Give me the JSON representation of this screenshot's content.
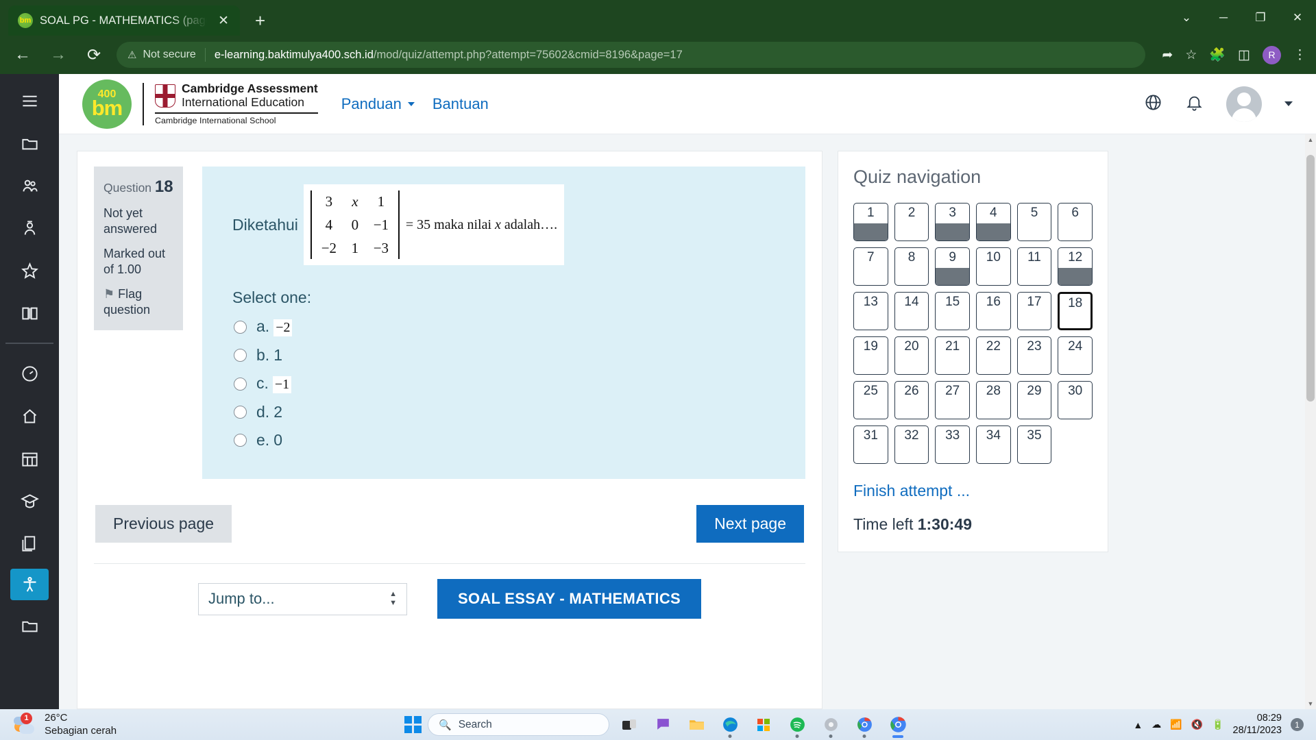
{
  "browser": {
    "tab": {
      "title": "SOAL PG - MATHEMATICS (page",
      "favicon": "bm-logo-icon",
      "close": "✕"
    },
    "new_tab": "+",
    "window_controls": {
      "minimize_group": "⌄",
      "minimize": "─",
      "maximize": "❐",
      "close": "✕"
    },
    "nav": {
      "back": "←",
      "forward": "→",
      "reload": "⟳"
    },
    "security_label": "Not secure",
    "url_host": "e-learning.baktimulya400.sch.id",
    "url_path": "/mod/quiz/attempt.php?attempt=75602&cmid=8196&page=17",
    "toolbar_icons": [
      "share-icon",
      "bookmark-star-icon",
      "extensions-puzzle-icon",
      "sidepanel-icon"
    ],
    "profile_initial": "R",
    "menu": "⋮"
  },
  "rail": {
    "items": [
      {
        "name": "hamburger-menu-icon"
      },
      {
        "name": "folder-icon"
      },
      {
        "name": "users-icon"
      },
      {
        "name": "badge-person-icon"
      },
      {
        "name": "star-icon"
      },
      {
        "name": "book-icon"
      },
      {
        "name": "dashboard-gauge-icon"
      },
      {
        "name": "home-icon"
      },
      {
        "name": "calendar-grid-icon"
      },
      {
        "name": "graduation-cap-icon"
      },
      {
        "name": "files-icon"
      },
      {
        "name": "folder-bottom-icon"
      }
    ],
    "accessibility_label": "accessibility-icon"
  },
  "site_header": {
    "logo_top": "400",
    "logo_text": "bm",
    "cambridge_line1": "Cambridge Assessment",
    "cambridge_line2": "International Education",
    "cambridge_sub": "Cambridge International School",
    "nav_links": [
      {
        "label": "Panduan",
        "has_caret": true
      },
      {
        "label": "Bantuan",
        "has_caret": false
      }
    ],
    "icons": [
      "language-globe-icon",
      "notification-bell-icon"
    ],
    "avatar": "user-avatar"
  },
  "question": {
    "number_label": "Question",
    "number": "18",
    "state": "Not yet answered",
    "marked_out_of": "Marked out of 1.00",
    "flag_label": "Flag question",
    "flag_icon": "⚑",
    "prompt_label": "Diketahui",
    "matrix": [
      [
        "3",
        "x",
        "1"
      ],
      [
        "4",
        "0",
        "−1"
      ],
      [
        "−2",
        "1",
        "−3"
      ]
    ],
    "matrix_italic_cells": [
      "0-1"
    ],
    "equation_tail_prefix": "= 35 maka nilai ",
    "equation_tail_var": "x",
    "equation_tail_suffix": " adalah….",
    "select_one": "Select one:",
    "options": [
      {
        "key": "a.",
        "value": "−2",
        "as_image": true
      },
      {
        "key": "b.",
        "value": "1",
        "as_image": false
      },
      {
        "key": "c.",
        "value": "−1",
        "as_image": true
      },
      {
        "key": "d.",
        "value": "2",
        "as_image": false
      },
      {
        "key": "e.",
        "value": "0",
        "as_image": false
      }
    ],
    "previous_button": "Previous page",
    "next_button": "Next page"
  },
  "bottom": {
    "jump_to": "Jump to...",
    "essay_button": "SOAL ESSAY - MATHEMATICS"
  },
  "quiz_navigation": {
    "title": "Quiz navigation",
    "boxes": [
      {
        "n": "1",
        "answered": true,
        "current": false
      },
      {
        "n": "2",
        "answered": false,
        "current": false
      },
      {
        "n": "3",
        "answered": true,
        "current": false
      },
      {
        "n": "4",
        "answered": true,
        "current": false
      },
      {
        "n": "5",
        "answered": false,
        "current": false
      },
      {
        "n": "6",
        "answered": false,
        "current": false
      },
      {
        "n": "7",
        "answered": false,
        "current": false
      },
      {
        "n": "8",
        "answered": false,
        "current": false
      },
      {
        "n": "9",
        "answered": true,
        "current": false
      },
      {
        "n": "10",
        "answered": false,
        "current": false
      },
      {
        "n": "11",
        "answered": false,
        "current": false
      },
      {
        "n": "12",
        "answered": true,
        "current": false
      },
      {
        "n": "13",
        "answered": false,
        "current": false
      },
      {
        "n": "14",
        "answered": false,
        "current": false
      },
      {
        "n": "15",
        "answered": false,
        "current": false
      },
      {
        "n": "16",
        "answered": false,
        "current": false
      },
      {
        "n": "17",
        "answered": false,
        "current": false
      },
      {
        "n": "18",
        "answered": false,
        "current": true
      },
      {
        "n": "19",
        "answered": false,
        "current": false
      },
      {
        "n": "20",
        "answered": false,
        "current": false
      },
      {
        "n": "21",
        "answered": false,
        "current": false
      },
      {
        "n": "22",
        "answered": false,
        "current": false
      },
      {
        "n": "23",
        "answered": false,
        "current": false
      },
      {
        "n": "24",
        "answered": false,
        "current": false
      },
      {
        "n": "25",
        "answered": false,
        "current": false
      },
      {
        "n": "26",
        "answered": false,
        "current": false
      },
      {
        "n": "27",
        "answered": false,
        "current": false
      },
      {
        "n": "28",
        "answered": false,
        "current": false
      },
      {
        "n": "29",
        "answered": false,
        "current": false
      },
      {
        "n": "30",
        "answered": false,
        "current": false
      },
      {
        "n": "31",
        "answered": false,
        "current": false
      },
      {
        "n": "32",
        "answered": false,
        "current": false
      },
      {
        "n": "33",
        "answered": false,
        "current": false
      },
      {
        "n": "34",
        "answered": false,
        "current": false
      },
      {
        "n": "35",
        "answered": false,
        "current": false
      }
    ],
    "finish_attempt": "Finish attempt ...",
    "time_left_label": "Time left ",
    "time_left_value": "1:30:49"
  },
  "taskbar": {
    "weather_temp": "26°C",
    "weather_cond": "Sebagian cerah",
    "weather_badge": "1",
    "search_placeholder": "Search",
    "apps": [
      "task-view-icon",
      "chat-teams-icon",
      "file-explorer-icon",
      "edge-browser-icon",
      "store-icon",
      "spotify-icon",
      "settings-gear-icon",
      "chrome-browser-icon",
      "chrome-browser-active-icon"
    ],
    "tray_icons": [
      "show-hidden-icons-chevron",
      "onedrive-icon",
      "wifi-icon",
      "volume-muted-icon",
      "battery-icon"
    ],
    "clock_time": "08:29",
    "clock_date": "28/11/2023",
    "notification_count": "1"
  },
  "colors": {
    "browser_chrome": "#1e4620",
    "moodle_blue": "#0f6cbf",
    "question_bg": "#dcf0f7",
    "rail_bg": "#26292f",
    "answered_fill": "#6c757d"
  }
}
